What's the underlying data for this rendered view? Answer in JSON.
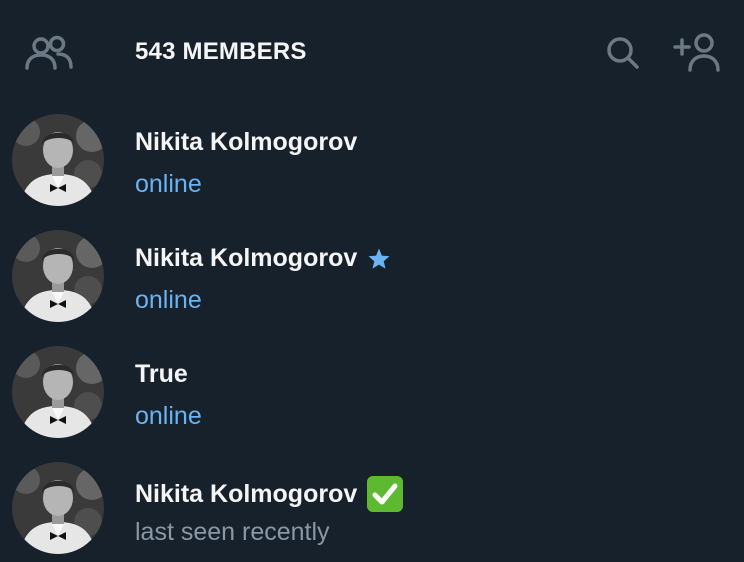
{
  "header": {
    "title": "543 MEMBERS",
    "left_icon": "members-icon",
    "right_icons": [
      "search-icon",
      "add-member-icon"
    ]
  },
  "members": [
    {
      "name": "Nikita Kolmogorov",
      "status": "online",
      "status_type": "online",
      "badge": ""
    },
    {
      "name": "Nikita Kolmogorov",
      "status": "online",
      "status_type": "online",
      "badge": "star-icon"
    },
    {
      "name": "True",
      "status": "online",
      "status_type": "online",
      "badge": ""
    },
    {
      "name": "Nikita Kolmogorov",
      "status": "last seen recently",
      "status_type": "recent",
      "badge": "check-icon"
    }
  ],
  "colors": {
    "background": "#17212b",
    "online": "#6ab3f3",
    "recent": "#8a97a4",
    "star": "#6ab3f3",
    "check": "#5cb930"
  }
}
